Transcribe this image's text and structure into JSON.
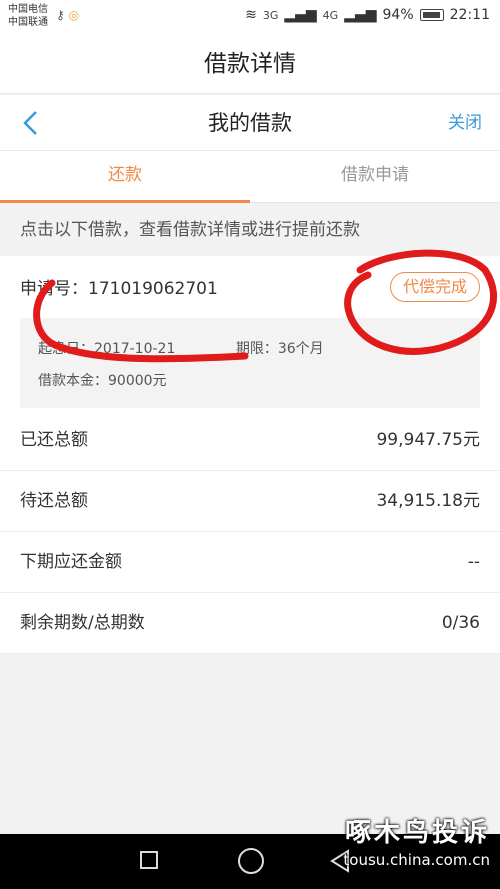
{
  "status_bar": {
    "carrier1": "中国电信",
    "carrier2": "中国联通",
    "signal1": "3G",
    "signal2": "4G",
    "battery": "94%",
    "time": "22:11"
  },
  "page_header": {
    "title": "借款详情"
  },
  "nav": {
    "title": "我的借款",
    "close": "关闭"
  },
  "tabs": [
    {
      "label": "还款"
    },
    {
      "label": "借款申请"
    }
  ],
  "hint": "点击以下借款，查看借款详情或进行提前还款",
  "loan": {
    "app_no_label": "申请号：",
    "app_no": "171019062701",
    "status": "代偿完成",
    "start_date_label": "起息日：",
    "start_date": "2017-10-21",
    "term_label": "期限：",
    "term": "36个月",
    "principal_label": "借款本金：",
    "principal": "90000元"
  },
  "summary": [
    {
      "label": "已还总额",
      "value": "99,947.75元"
    },
    {
      "label": "待还总额",
      "value": "34,915.18元"
    },
    {
      "label": "下期应还金额",
      "value": "--"
    },
    {
      "label": "剩余期数/总期数",
      "value": "0/36"
    }
  ],
  "watermark": {
    "title": "啄木鸟投诉",
    "url": "tousu.china.com.cn"
  },
  "colors": {
    "accent": "#f08a4b",
    "link": "#3a9ad9",
    "annotation": "#e01b1b"
  }
}
